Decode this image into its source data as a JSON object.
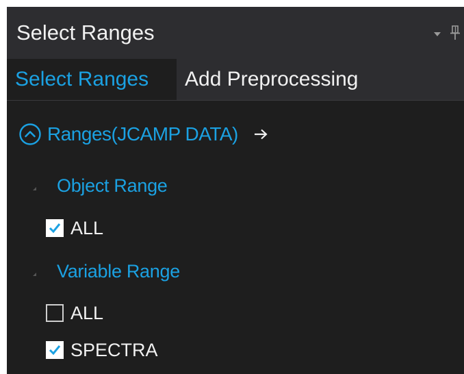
{
  "panel": {
    "title": "Select Ranges",
    "controls": [
      "dropdown-arrow-icon",
      "pin-icon"
    ]
  },
  "tabs": [
    {
      "label": "Select Ranges",
      "active": true
    },
    {
      "label": "Add Preprocessing",
      "active": false
    }
  ],
  "ranges": {
    "header_label": "Ranges(JCAMP DATA)",
    "header_icon": "chevron-up-circle-icon",
    "arrow_icon": "right-arrow-icon",
    "object_range": {
      "label": "Object Range",
      "items": [
        {
          "label": "ALL",
          "checked": true
        }
      ]
    },
    "variable_range": {
      "label": "Variable Range",
      "items": [
        {
          "label": "ALL",
          "checked": false
        },
        {
          "label": "SPECTRA",
          "checked": true
        }
      ]
    }
  },
  "colors": {
    "accent": "#1ba1e2",
    "background": "#1e1e1e",
    "titlebar": "#2d2d30",
    "text": "#f1f1f1"
  }
}
